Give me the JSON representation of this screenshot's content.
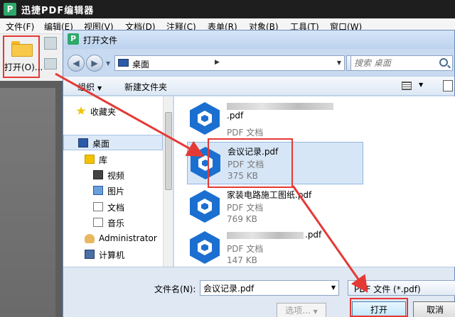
{
  "app": {
    "title": "迅捷PDF编辑器",
    "icon_letter": "P",
    "menu": [
      "文件(F)",
      "编辑(E)",
      "视图(V)",
      "文档(D)",
      "注释(C)",
      "表单(R)",
      "对象(B)",
      "工具(T)",
      "窗口(W)"
    ]
  },
  "toolbar": {
    "open_label": "打开(O)..."
  },
  "dialog": {
    "title": "打开文件",
    "icon_letter": "P",
    "address": {
      "crumb": "桌面"
    },
    "search": {
      "placeholder": "搜索 桌面"
    },
    "commands": {
      "organize": "组织",
      "new_folder": "新建文件夹"
    },
    "nav": [
      {
        "label": "收藏夹",
        "icon": "star-icon"
      },
      {
        "label": "桌面",
        "icon": "desktop-icon",
        "selected": true
      },
      {
        "label": "库",
        "icon": "library-icon"
      },
      {
        "label": "视频",
        "icon": "video-icon"
      },
      {
        "label": "图片",
        "icon": "pictures-icon"
      },
      {
        "label": "文档",
        "icon": "documents-icon"
      },
      {
        "label": "音乐",
        "icon": "music-icon"
      },
      {
        "label": "Administrator",
        "icon": "user-icon"
      },
      {
        "label": "计算机",
        "icon": "computer-icon"
      }
    ],
    "files": [
      {
        "name_suffix": ".pdf",
        "type": "PDF 文档",
        "size": ""
      },
      {
        "name": "会议记录.pdf",
        "type": "PDF 文档",
        "size": "375 KB",
        "selected": true
      },
      {
        "name": "家装电路施工图纸.pdf",
        "type": "PDF 文档",
        "size": "769 KB"
      },
      {
        "name_suffix": ".pdf",
        "type": "PDF 文档",
        "size": "147 KB"
      }
    ],
    "filename_label": "文件名(N):",
    "filename_value": "会议记录.pdf",
    "filetype_value": "PDF 文件 (*.pdf)",
    "options_button": "选项...",
    "open_button": "打开",
    "cancel_button": "取消"
  },
  "colors": {
    "annotation": "#e53935",
    "selection": "#d7e6f7",
    "file_icon": "#1b6fd0"
  }
}
